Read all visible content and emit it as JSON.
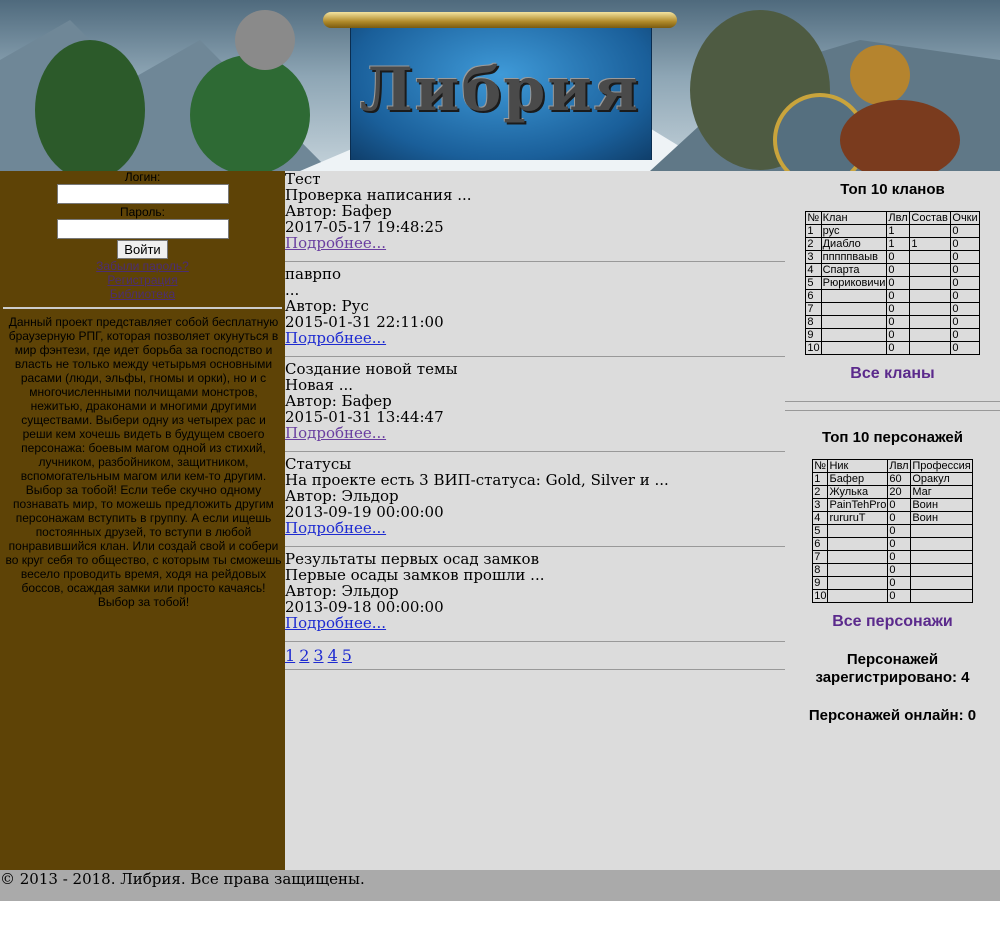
{
  "banner": {
    "logo": "Либрия"
  },
  "login": {
    "login_label": "Логин:",
    "password_label": "Пароль:",
    "submit": "Войти",
    "forgot": "Забыли пароль?",
    "register": "Регистрация",
    "library": "Библиотека"
  },
  "about": "Данный проект представляет собой бесплатную браузерную РПГ, которая позволяет окунуться в мир фэнтези, где идет борьба за господство и власть не только между четырьмя основными расами (люди, эльфы, гномы и орки), но и с многочисленными полчищами монстров, нежитью, драконами и многими другими существами. Выбери одну из четырех рас и реши кем хочешь видеть в будущем своего персонажа: боевым магом одной из стихий, лучником, разбойником, защитником, вспомогательным магом или кем-то другим. Выбор за тобой! Если тебе скучно одному познавать мир, то можешь предложить другим персонажам вступить в группу. А если ищешь постоянных друзей, то вступи в любой понравившийся клан. Или создай свой и собери во круг себя то общество, с которым ты сможешь весело проводить время, ходя на рейдовых боссов, осаждая замки или просто качаясь! Выбор за тобой!",
  "news": [
    {
      "title": "Тест",
      "preview": "Проверка написания ...",
      "author": "Автор: Бафер",
      "date": "2017-05-17 19:48:25",
      "more": "Подробнее..."
    },
    {
      "title": "паврпо",
      "preview": "...",
      "author": "Автор: Рус",
      "date": "2015-01-31 22:11:00",
      "more": "Подробнее..."
    },
    {
      "title": "Создание новой темы",
      "preview": "Новая ...",
      "author": "Автор: Бафер",
      "date": "2015-01-31 13:44:47",
      "more": "Подробнее..."
    },
    {
      "title": "Статусы",
      "preview": "На проекте есть 3 ВИП-статуса: Gold, Silver и ...",
      "author": "Автор: Эльдор",
      "date": "2013-09-19 00:00:00",
      "more": "Подробнее..."
    },
    {
      "title": "Результаты первых осад замков",
      "preview": "Первые осады замков прошли ...",
      "author": "Автор: Эльдор",
      "date": "2013-09-18 00:00:00",
      "more": "Подробнее..."
    }
  ],
  "pager": [
    "1",
    "2",
    "3",
    "4",
    "5"
  ],
  "clans": {
    "title": "Топ 10 кланов",
    "headers": [
      "№",
      "Клан",
      "Лвл",
      "Состав",
      "Очки"
    ],
    "rows": [
      [
        "1",
        "рус",
        "1",
        "",
        "0"
      ],
      [
        "2",
        "Диабло",
        "1",
        "1",
        "0"
      ],
      [
        "3",
        "пппппваыв",
        "0",
        "",
        "0"
      ],
      [
        "4",
        "Спарта",
        "0",
        "",
        "0"
      ],
      [
        "5",
        "Рюриковичи",
        "0",
        "",
        "0"
      ],
      [
        "6",
        "",
        "0",
        "",
        "0"
      ],
      [
        "7",
        "",
        "0",
        "",
        "0"
      ],
      [
        "8",
        "",
        "0",
        "",
        "0"
      ],
      [
        "9",
        "",
        "0",
        "",
        "0"
      ],
      [
        "10",
        "",
        "0",
        "",
        "0"
      ]
    ],
    "all_link": "Все кланы"
  },
  "chars": {
    "title": "Топ 10 персонажей",
    "headers": [
      "№",
      "Ник",
      "Лвл",
      "Профессия"
    ],
    "rows": [
      [
        "1",
        "Бафер",
        "60",
        "Оракул"
      ],
      [
        "2",
        "Жулька",
        "20",
        "Маг"
      ],
      [
        "3",
        "PainTehPro",
        "0",
        "Воин"
      ],
      [
        "4",
        "rururuT",
        "0",
        "Воин"
      ],
      [
        "5",
        "",
        "0",
        ""
      ],
      [
        "6",
        "",
        "0",
        ""
      ],
      [
        "7",
        "",
        "0",
        ""
      ],
      [
        "8",
        "",
        "0",
        ""
      ],
      [
        "9",
        "",
        "0",
        ""
      ],
      [
        "10",
        "",
        "0",
        ""
      ]
    ],
    "all_link": "Все персонажи"
  },
  "stats": {
    "registered": "Персонажей зарегистрировано: 4",
    "online": "Персонажей онлайн: 0"
  },
  "footer": "© 2013 - 2018. Либрия. Все права защищены."
}
